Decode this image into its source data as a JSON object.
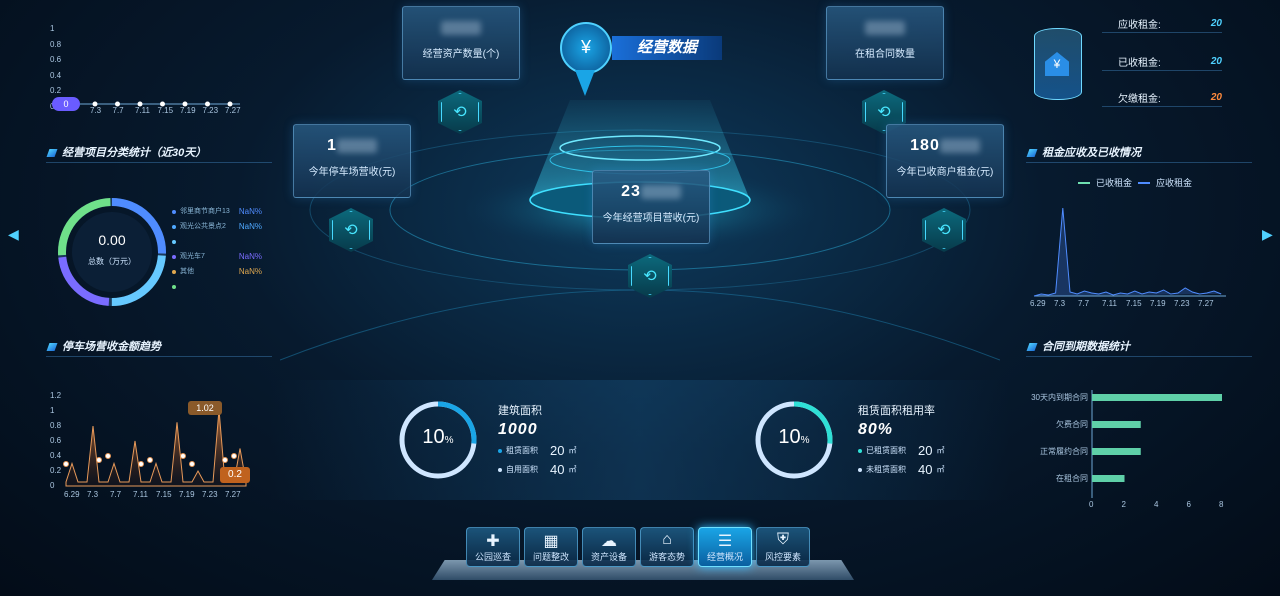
{
  "center_title": "经营数据",
  "top_cards": {
    "asset_count": {
      "value": "",
      "label": "经营资产数量(个)"
    },
    "contract_count": {
      "value": "",
      "label": "在租合同数量"
    },
    "parking_revenue": {
      "value": "1",
      "label": "今年停车场营收(元)"
    },
    "tenant_rent": {
      "value": "180",
      "label": "今年已收商户租金(元)"
    },
    "project_revenue": {
      "value": "23",
      "label": "今年经营项目营收(元)"
    }
  },
  "top_left_chart": {
    "y_ticks": [
      "1",
      "0.8",
      "0.6",
      "0.4",
      "0.2",
      "0"
    ],
    "x_ticks": [
      "7.3",
      "7.7",
      "7.11",
      "7.15",
      "7.19",
      "7.23",
      "7.27"
    ],
    "badge": "0"
  },
  "category_stats": {
    "title": "经营项目分类统计（近30天）",
    "total_value": "0.00",
    "total_label": "总数（万元）",
    "legend": [
      {
        "name": "邻里商节商户13",
        "value": "NaN%",
        "color": "#4f8cff"
      },
      {
        "name": "观光公共景点2",
        "value": "NaN%",
        "color": "#4fa8ff"
      },
      {
        "name": "",
        "value": "",
        "color": "#66c9ff"
      },
      {
        "name": "观光车7",
        "value": "NaN%",
        "color": "#7a6cff"
      },
      {
        "name": "其他",
        "value": "NaN%",
        "color": "#e0a84f"
      },
      {
        "name": "",
        "value": "",
        "color": "#6fe08a"
      }
    ]
  },
  "parking_trend": {
    "title": "停车场营收金额趋势",
    "y_ticks": [
      "1.2",
      "1",
      "0.8",
      "0.6",
      "0.4",
      "0.2",
      "0"
    ],
    "x_ticks": [
      "6.29",
      "7.3",
      "7.7",
      "7.11",
      "7.15",
      "7.19",
      "7.23",
      "7.27"
    ],
    "max_label": "1.02",
    "min_label": "0.2"
  },
  "rent": {
    "receivable_label": "应收租金:",
    "receivable_value": "20",
    "received_label": "已收租金:",
    "received_value": "20",
    "arrears_label": "欠缴租金:",
    "arrears_value": "20"
  },
  "rent_chart": {
    "title": "租金应收及已收情况",
    "legend_received": "已收租金",
    "legend_receivable": "应收租金",
    "x_ticks": [
      "6.29",
      "7.3",
      "7.7",
      "7.11",
      "7.15",
      "7.19",
      "7.23",
      "7.27"
    ]
  },
  "contract_stats": {
    "title": "合同到期数据统计",
    "x_ticks": [
      "0",
      "2",
      "4",
      "6",
      "8"
    ]
  },
  "building": {
    "percent": "10",
    "percent_unit": "%",
    "title": "建筑面积",
    "value": "1000",
    "row1_label": "租赁面积",
    "row1_value": "20",
    "row2_label": "自用面积",
    "row2_value": "40",
    "unit": "㎡"
  },
  "lease_rate": {
    "percent": "10",
    "percent_unit": "%",
    "title": "租赁面积租用率",
    "value": "80%",
    "row1_label": "已租赁面积",
    "row1_value": "20",
    "row2_label": "未租赁面积",
    "row2_value": "40",
    "unit": "㎡"
  },
  "nav": [
    {
      "label": "公园巡查",
      "icon": "✚"
    },
    {
      "label": "问题整改",
      "icon": "▦"
    },
    {
      "label": "资产设备",
      "icon": "☁"
    },
    {
      "label": "游客态势",
      "icon": "⌂"
    },
    {
      "label": "经营概况",
      "icon": "☰"
    },
    {
      "label": "风控要素",
      "icon": "⛨"
    }
  ],
  "chart_data": [
    {
      "type": "line",
      "title": "停车场营收金额趋势",
      "x": [
        "6.29",
        "7.3",
        "7.7",
        "7.11",
        "7.15",
        "7.19",
        "7.23",
        "7.27"
      ],
      "series": [
        {
          "values": [
            0.3,
            0.8,
            0.3,
            0.6,
            0.3,
            0.85,
            0.2,
            1.02,
            0.5
          ]
        }
      ],
      "ylim": [
        0,
        1.2
      ]
    },
    {
      "type": "bar",
      "title": "合同到期数据统计",
      "categories": [
        "30天内到期合同",
        "欠费合同",
        "正常履约合同",
        "在租合同"
      ],
      "values": [
        8,
        3,
        3,
        2
      ],
      "xlim": [
        0,
        8
      ],
      "orientation": "horizontal"
    }
  ]
}
